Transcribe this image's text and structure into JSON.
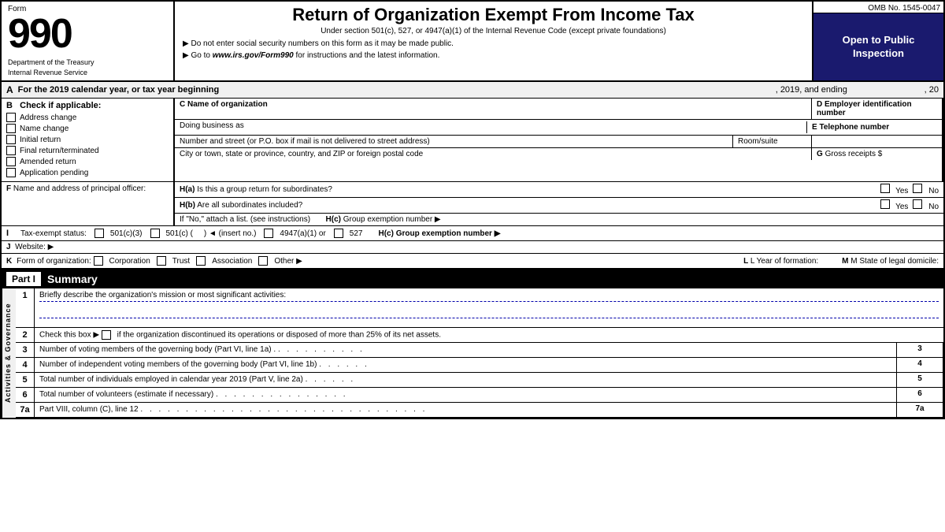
{
  "header": {
    "form_label": "Form",
    "form_number": "990",
    "title": "Return of Organization Exempt From Income Tax",
    "subtitle": "Under section 501(c), 527, or 4947(a)(1) of the Internal Revenue Code (except private foundations)",
    "bullet1": "▶ Do not enter social security numbers on this form as it may be made public.",
    "bullet2": "▶ Go to www.irs.gov/Form990 for instructions and the latest information.",
    "omb": "OMB No. 1545-0047",
    "open_public": "Open to Public Inspection",
    "dept1": "Department of the Treasury",
    "dept2": "Internal Revenue Service"
  },
  "section_a": {
    "label": "A",
    "text": "For the 2019 calendar year, or tax year beginning",
    "year_text": ", 2019, and ending",
    "year_end": ", 20"
  },
  "section_b": {
    "label": "B",
    "check_label": "Check if applicable:",
    "items": [
      "Address change",
      "Name change",
      "Initial return",
      "Final return/terminated",
      "Amended return",
      "Application pending"
    ]
  },
  "section_c": {
    "label": "C",
    "name_label": "Name of organization",
    "dba_label": "Doing business as",
    "street_label": "Number and street (or P.O. box if mail is not delivered to street address)",
    "room_label": "Room/suite",
    "city_label": "City or town, state or province, country, and ZIP or foreign postal code"
  },
  "section_d": {
    "label": "D",
    "text": "Employer identification number"
  },
  "section_e": {
    "label": "E",
    "text": "Telephone number"
  },
  "section_f": {
    "label": "F",
    "text": "Name and address of principal officer:"
  },
  "section_g": {
    "label": "G",
    "text": "Gross receipts $"
  },
  "section_h": {
    "ha": "H(a) Is this a group return for subordinates?",
    "hb": "H(b) Are all subordinates included?",
    "hc": "H(c) Group exemption number ▶",
    "yes": "Yes",
    "no": "No",
    "if_no": "If \"No,\" attach a list. (see instructions)"
  },
  "section_i": {
    "label": "I",
    "text": "Tax-exempt status:",
    "options": [
      "501(c)(3)",
      "501(c) (",
      ") ◄ (insert no.)",
      "4947(a)(1) or",
      "527"
    ]
  },
  "section_j": {
    "label": "J",
    "text": "Website: ▶"
  },
  "section_k": {
    "label": "K",
    "text": "Form of organization:",
    "options": [
      "Corporation",
      "Trust",
      "Association",
      "Other ▶"
    ],
    "l_label": "L Year of formation:",
    "m_label": "M State of legal domicile:"
  },
  "part1": {
    "label": "Part I",
    "title": "Summary",
    "side_label": "Activities & Governance",
    "rows": [
      {
        "num": "1",
        "text": "Briefly describe the organization's mission or most significant activities:",
        "number_label": ""
      },
      {
        "num": "2",
        "text": "Check this box ▶ □ if the organization discontinued its operations or disposed of more than 25% of its net assets.",
        "number_label": ""
      },
      {
        "num": "3",
        "text": "Number of voting members of the governing body (Part VI, line 1a) .",
        "dots": ". . . . . . . . . .",
        "number_label": "3"
      },
      {
        "num": "4",
        "text": "Number of independent voting members of the governing body (Part VI, line 1b)",
        "dots": ". . . . . .",
        "number_label": "4"
      },
      {
        "num": "5",
        "text": "Total number of individuals employed in calendar year 2019 (Part V, line 2a)",
        "dots": ". . . . . .",
        "number_label": "5"
      },
      {
        "num": "6",
        "text": "Total number of volunteers (estimate if necessary)",
        "dots": ". . . . . . . . . . . . . . .",
        "number_label": "6"
      },
      {
        "num": "7a",
        "text": "Part VIII, column (C), line 12",
        "number_label": "7a"
      }
    ]
  }
}
